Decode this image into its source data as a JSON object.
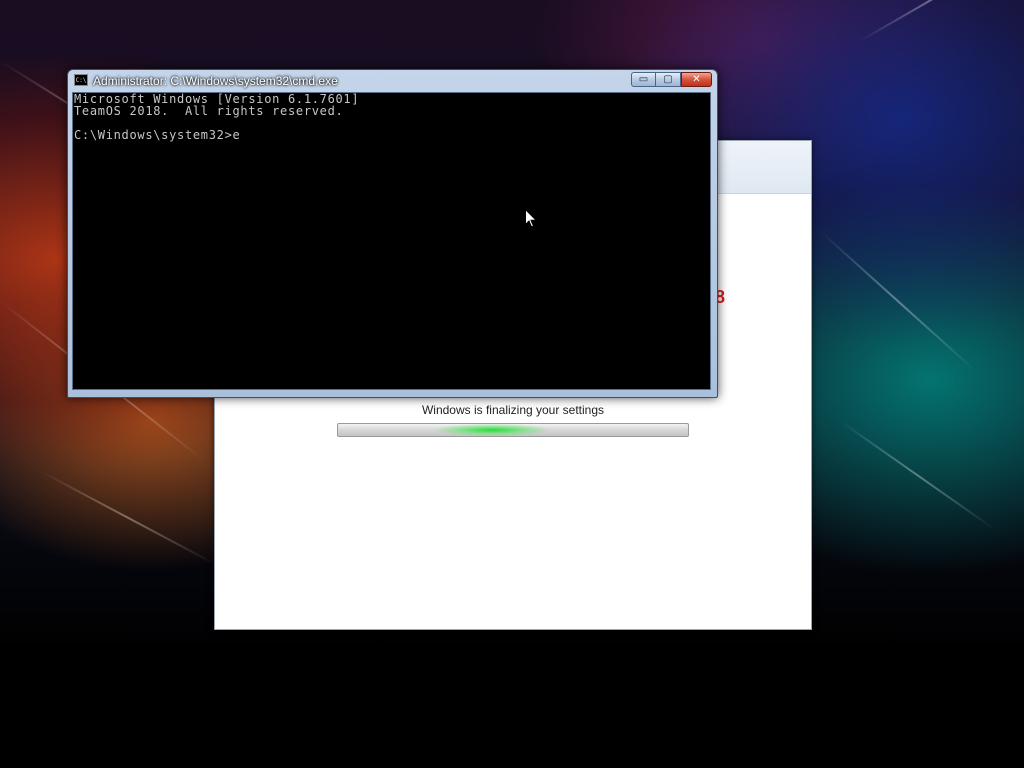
{
  "cmd_window": {
    "title": "Administrator: C:\\Windows\\system32\\cmd.exe",
    "icon_label": "C:\\",
    "buttons": {
      "minimize": "▭",
      "maximize": "▢",
      "close": "✕"
    },
    "console_lines": [
      "Microsoft Windows [Version 6.1.7601]",
      "TeamOS 2018.  All rights reserved.",
      "",
      "C:\\Windows\\system32>e"
    ]
  },
  "setup_window": {
    "partial_text": "8",
    "status_text": "Windows is finalizing your settings",
    "progress": {
      "indeterminate": true,
      "glow_start_fraction": 0.28,
      "glow_end_fraction": 0.6,
      "glow_color": "#28dc3c"
    }
  },
  "cursor": {
    "icon": "arrow-pointer-icon"
  }
}
